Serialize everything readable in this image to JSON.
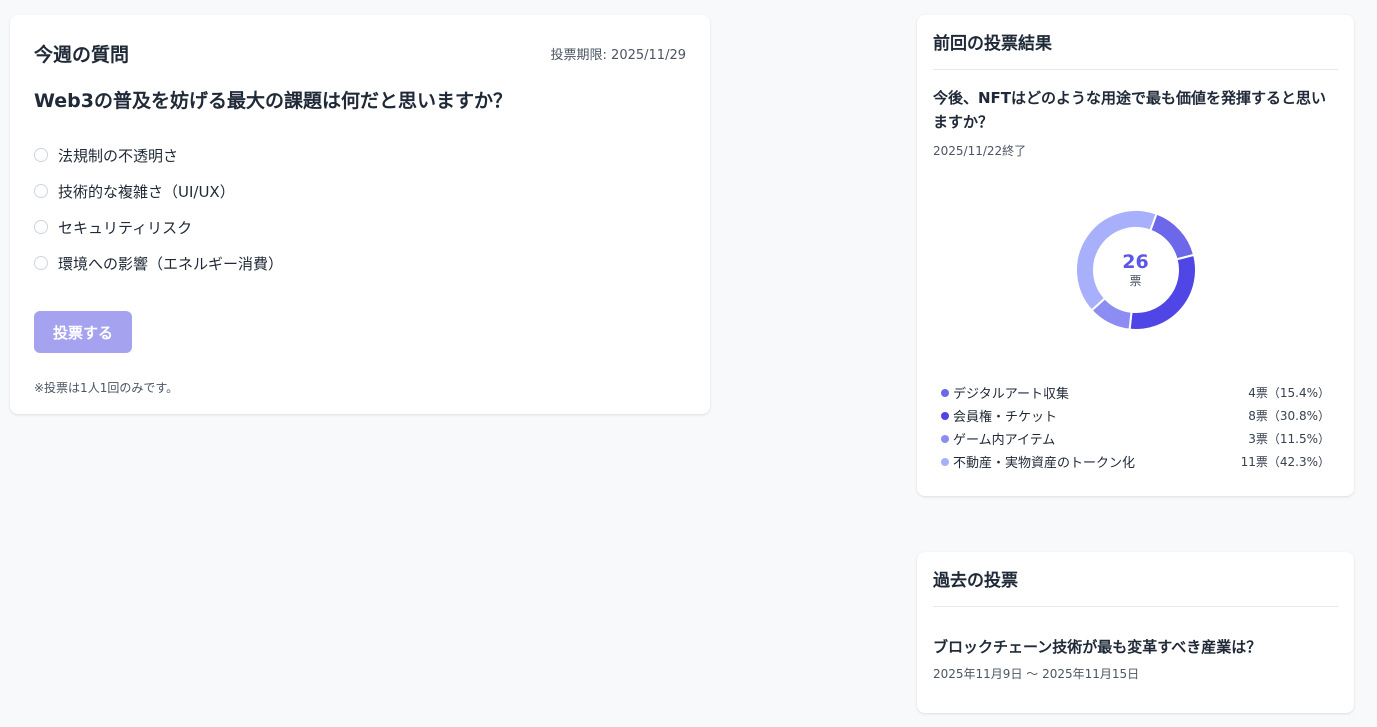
{
  "current_poll": {
    "title": "今週の質問",
    "deadline": "投票期限: 2025/11/29",
    "question": "Web3の普及を妨げる最大の課題は何だと思いますか？",
    "options": [
      "法規制の不透明さ",
      "技術的な複雑さ（UI/UX）",
      "セキュリティリスク",
      "環境への影響（エネルギー消費）"
    ],
    "vote_button_label": "投票する",
    "note": "※投票は1人1回のみです。"
  },
  "previous_results": {
    "heading": "前回の投票結果",
    "question": "今後、NFTはどのような用途で最も価値を発揮すると思いますか？",
    "ended": "2025/11/22終了",
    "total_label": "26",
    "total_unit": "票",
    "results": [
      {
        "label": "デジタルアート収集",
        "votes_text": "4票（15.4%）",
        "votes": 4,
        "color": "#6d68ea"
      },
      {
        "label": "会員権・チケット",
        "votes_text": "8票（30.8%）",
        "votes": 8,
        "color": "#4f46e5"
      },
      {
        "label": "ゲーム内アイテム",
        "votes_text": "3票（11.5%）",
        "votes": 3,
        "color": "#8b8df2"
      },
      {
        "label": "不動産・実物資産のトークン化",
        "votes_text": "11票（42.3%）",
        "votes": 11,
        "color": "#a9b0fb"
      }
    ]
  },
  "chart_data": {
    "type": "pie",
    "categories": [
      "デジタルアート収集",
      "会員権・チケット",
      "ゲーム内アイテム",
      "不動産・実物資産のトークン化"
    ],
    "values": [
      4,
      8,
      3,
      11
    ],
    "title": "",
    "legend": "bottom"
  },
  "past_polls": {
    "heading": "過去の投票",
    "items": [
      {
        "title": "ブロックチェーン技術が最も変革すべき産業は？",
        "range": "2025年11月9日 〜 2025年11月15日"
      }
    ]
  }
}
